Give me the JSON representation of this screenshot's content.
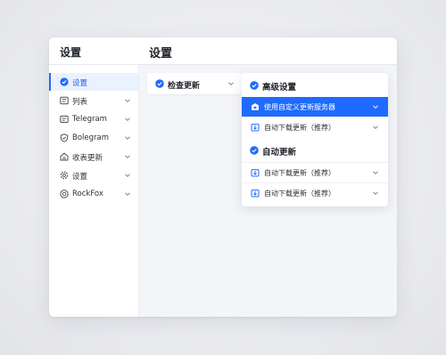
{
  "app": {
    "title": "设置"
  },
  "page": {
    "title": "设置"
  },
  "sidebar": {
    "items": [
      {
        "label": "设置",
        "icon": "settings-circle-icon",
        "active": true
      },
      {
        "label": "列表",
        "icon": "list-icon"
      },
      {
        "label": "Telegram",
        "icon": "chat-icon"
      },
      {
        "label": "Bolegram",
        "icon": "shield-icon"
      },
      {
        "label": "收表更新",
        "icon": "home-icon"
      },
      {
        "label": "设置",
        "icon": "gear-icon"
      },
      {
        "label": "RockFox",
        "icon": "target-icon"
      }
    ]
  },
  "main": {
    "check_update": {
      "label": "检查更新",
      "icon": "check-badge-icon"
    },
    "advanced": {
      "header": "高级设置",
      "options": [
        {
          "label": "使用自定义更新服务器",
          "icon": "server-box-icon",
          "selected": true
        },
        {
          "label": "自动下载更新（推荐）",
          "icon": "download-box-icon"
        }
      ]
    },
    "auto_update": {
      "header": "自动更新",
      "options": [
        {
          "label": "自动下载更新（推荐）",
          "icon": "download-box-icon"
        },
        {
          "label": "自动下载更新（推荐）",
          "icon": "download-box-icon"
        }
      ]
    }
  },
  "colors": {
    "accent": "#1f6bff",
    "active_bg": "#eaf1ff",
    "text": "#1f2329"
  }
}
